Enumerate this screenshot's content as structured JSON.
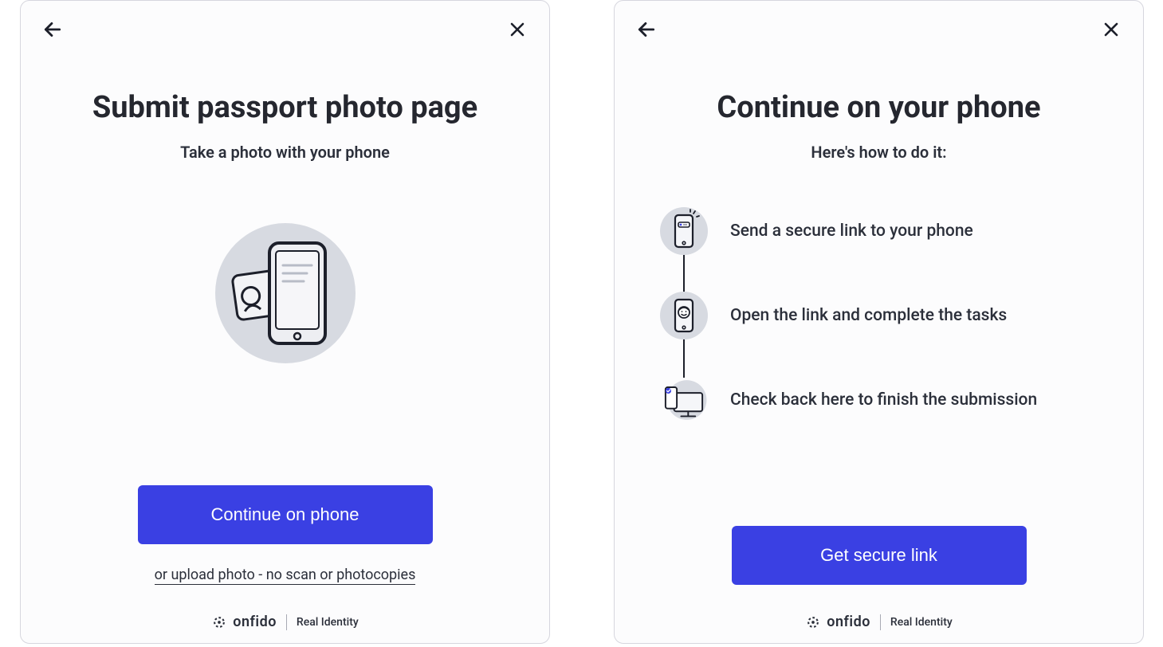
{
  "panel_left": {
    "title": "Submit passport photo page",
    "subtitle": "Take a photo with your phone",
    "primary_button": "Continue on phone",
    "secondary_link": "or upload photo - no scan or photocopies"
  },
  "panel_right": {
    "title": "Continue on your phone",
    "subtitle": "Here's how to do it:",
    "steps": [
      {
        "text": "Send a secure link to your phone"
      },
      {
        "text": "Open the link and complete the tasks"
      },
      {
        "text": "Check back here to finish the submission"
      }
    ],
    "primary_button": "Get secure link"
  },
  "footer": {
    "brand": "onfido",
    "tagline": "Real Identity"
  },
  "colors": {
    "primary": "#3a40e3",
    "text": "#2b2f3a"
  }
}
